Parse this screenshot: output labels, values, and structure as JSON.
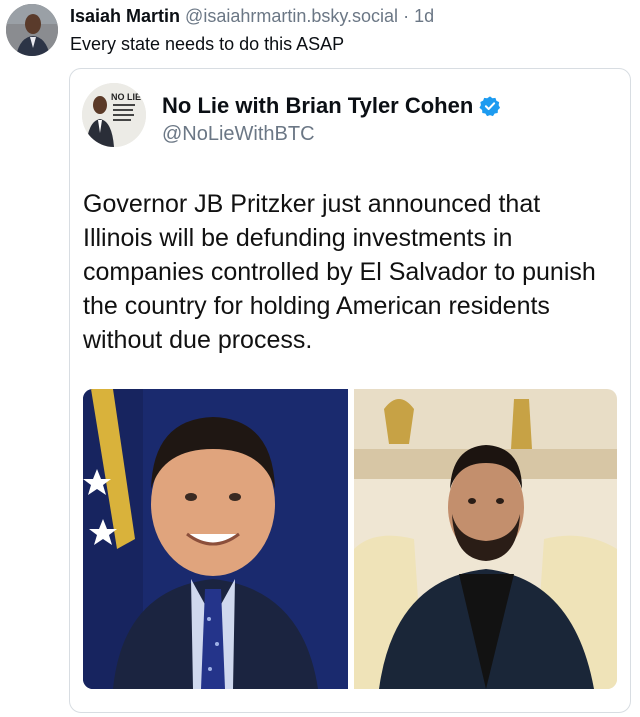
{
  "post": {
    "author_name": "Isaiah Martin",
    "author_handle": "@isaiahrmartin.bsky.social",
    "separator": "·",
    "age": "1d",
    "text": "Every state needs to do this ASAP"
  },
  "quoted": {
    "name": "No Lie with Brian Tyler Cohen",
    "handle": "@NoLieWithBTC",
    "avatar_logo_text": "NO LIE BRIAN TYLER COHEN",
    "body": "Governor JB Pritzker just announced that Illinois will be defunding investments in companies controlled by El Salvador to punish the country for holding American residents without due process."
  },
  "icons": {
    "verified": "verified-badge-icon"
  },
  "colors": {
    "handle_gray": "#6b7785",
    "verified_blue": "#1d9bf0",
    "border": "#d8dde2"
  }
}
